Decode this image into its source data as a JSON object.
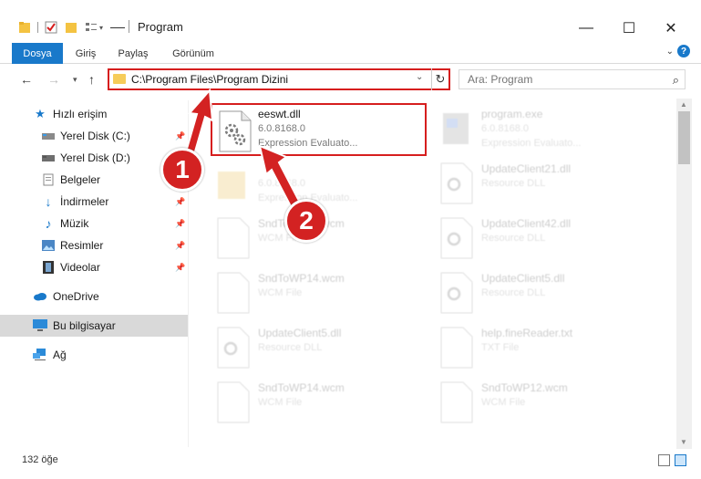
{
  "window": {
    "title": "Program",
    "minimize": "—",
    "maximize": "☐",
    "close": "✕"
  },
  "ribbon": {
    "tabs": [
      "Dosya",
      "Giriş",
      "Paylaş",
      "Görünüm"
    ],
    "help": "?"
  },
  "nav": {
    "address": "C:\\Program Files\\Program Dizini",
    "search_placeholder": "Ara: Program"
  },
  "sidebar": {
    "items": [
      {
        "label": "Hızlı erişim",
        "icon": "star-icon"
      },
      {
        "label": "Yerel Disk (C:)",
        "icon": "drive-icon"
      },
      {
        "label": "Yerel Disk (D:)",
        "icon": "drive-icon"
      },
      {
        "label": "Belgeler",
        "icon": "documents-icon"
      },
      {
        "label": "İndirmeler",
        "icon": "download-icon"
      },
      {
        "label": "Müzik",
        "icon": "music-icon"
      },
      {
        "label": "Resimler",
        "icon": "pictures-icon"
      },
      {
        "label": "Videolar",
        "icon": "video-icon"
      },
      {
        "label": "OneDrive",
        "icon": "cloud-icon"
      },
      {
        "label": "Bu bilgisayar",
        "icon": "computer-icon"
      },
      {
        "label": "Ağ",
        "icon": "network-icon"
      }
    ]
  },
  "files": [
    {
      "name": "eeswt.dll",
      "line1": "6.0.8168.0",
      "line2": "Expression Evaluato..."
    },
    {
      "name": "program.exe",
      "line1": "6.0.8168.0",
      "line2": "Expression Evaluato..."
    },
    {
      "name": "",
      "line1": "6.0.8168.0",
      "line2": "Expression Evaluato..."
    },
    {
      "name": "UpdateClient21.dll",
      "line1": "Resource DLL",
      "line2": ""
    },
    {
      "name": "SndToWP13.wcm",
      "line1": "WCM File",
      "line2": ""
    },
    {
      "name": "UpdateClient42.dll",
      "line1": "Resource DLL",
      "line2": ""
    },
    {
      "name": "SndToWP14.wcm",
      "line1": "WCM File",
      "line2": ""
    },
    {
      "name": "UpdateClient5.dll",
      "line1": "Resource DLL",
      "line2": ""
    },
    {
      "name": "UpdateClient5.dll",
      "line1": "Resource DLL",
      "line2": ""
    },
    {
      "name": "help.fineReader.txt",
      "line1": "TXT File",
      "line2": ""
    },
    {
      "name": "SndToWP14.wcm",
      "line1": "WCM File",
      "line2": ""
    },
    {
      "name": "SndToWP12.wcm",
      "line1": "WCM File",
      "line2": ""
    }
  ],
  "status": {
    "count": "132 öğe"
  },
  "callouts": [
    "1",
    "2"
  ],
  "colors": {
    "accent": "#1979ca",
    "highlight": "#d61e1e",
    "callout": "#d32222"
  }
}
